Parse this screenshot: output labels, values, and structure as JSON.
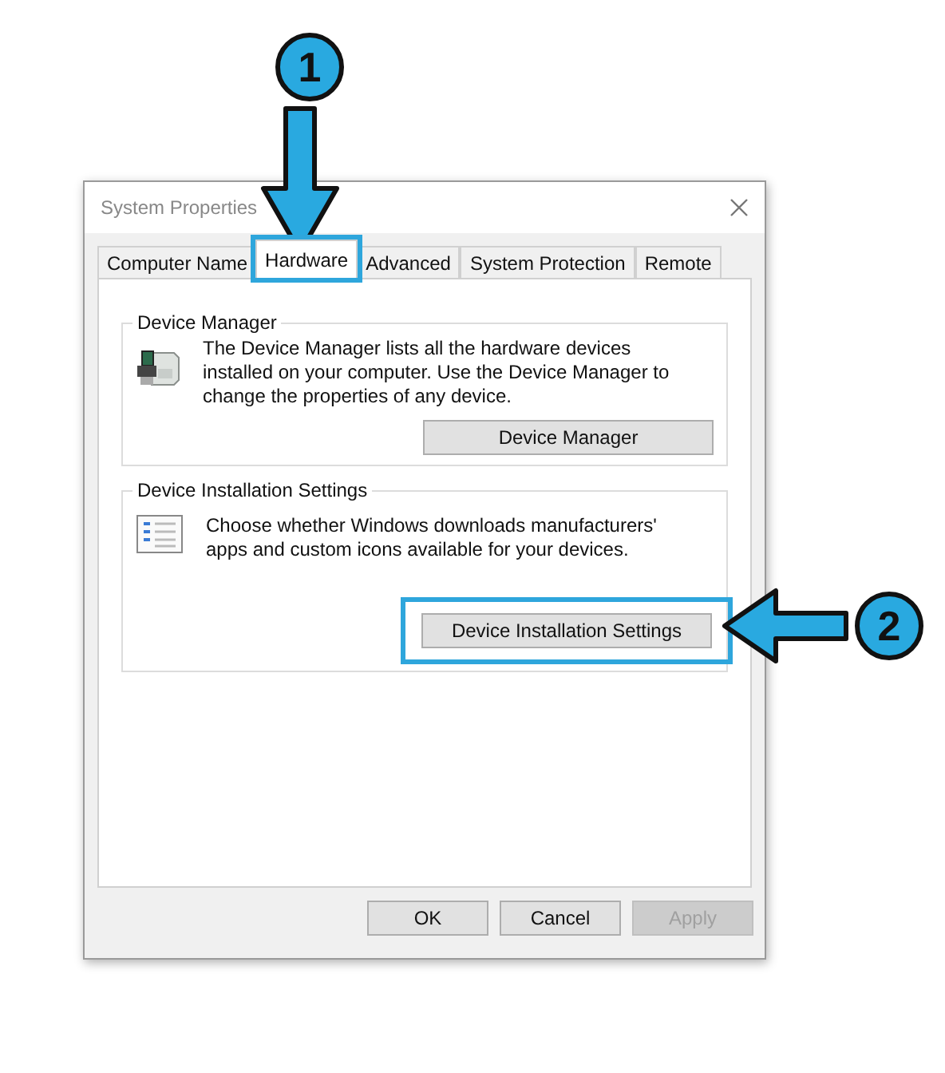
{
  "window": {
    "title": "System Properties"
  },
  "tabs": [
    {
      "label": "Computer Name",
      "selected": false,
      "highlighted": false
    },
    {
      "label": "Hardware",
      "selected": true,
      "highlighted": true
    },
    {
      "label": "Advanced",
      "selected": false,
      "highlighted": false
    },
    {
      "label": "System Protection",
      "selected": false,
      "highlighted": false
    },
    {
      "label": "Remote",
      "selected": false,
      "highlighted": false
    }
  ],
  "groups": [
    {
      "kind": "device",
      "title": "Device Manager",
      "description": "The Device Manager lists all the hardware devices installed on your computer. Use the Device Manager to change the properties of any device.",
      "button": {
        "label": "Device Manager",
        "highlighted": false
      }
    },
    {
      "kind": "checklist",
      "title": "Device Installation Settings",
      "description": "Choose whether Windows downloads manufacturers' apps and custom icons available for your devices.",
      "button": {
        "label": "Device Installation Settings",
        "highlighted": true
      }
    }
  ],
  "buttons": [
    {
      "label": "OK",
      "disabled": false
    },
    {
      "label": "Cancel",
      "disabled": false
    },
    {
      "label": "Apply",
      "disabled": true
    }
  ],
  "callouts": [
    {
      "label": "1",
      "kind": "down"
    },
    {
      "label": "2",
      "kind": "left"
    }
  ]
}
